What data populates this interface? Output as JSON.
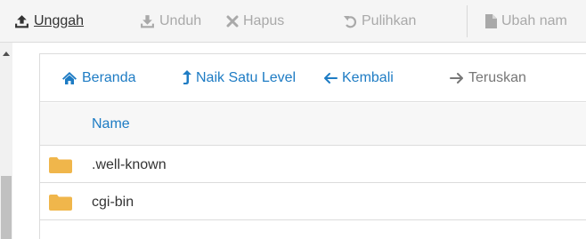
{
  "toolbar": {
    "upload": {
      "label": "Unggah",
      "icon": "upload-icon"
    },
    "download": {
      "label": "Unduh",
      "icon": "download-icon"
    },
    "delete": {
      "label": "Hapus",
      "icon": "x-icon"
    },
    "restore": {
      "label": "Pulihkan",
      "icon": "undo-icon"
    },
    "rename": {
      "label": "Ubah nam",
      "icon": "file-icon"
    }
  },
  "nav": {
    "home": {
      "label": "Beranda",
      "icon": "home-icon"
    },
    "up": {
      "label": "Naik Satu Level",
      "icon": "level-up-icon"
    },
    "back": {
      "label": "Kembali",
      "icon": "arrow-left-icon"
    },
    "forward": {
      "label": "Teruskan",
      "icon": "arrow-right-icon"
    }
  },
  "table": {
    "column_name": "Name",
    "rows": [
      {
        "name": ".well-known",
        "icon": "folder-icon"
      },
      {
        "name": "cgi-bin",
        "icon": "folder-icon"
      }
    ]
  },
  "colors": {
    "link": "#1e7cc4",
    "folder": "#f0b64b",
    "disabled": "#a9a9a9",
    "toolbar_bg": "#f5f5f5"
  }
}
